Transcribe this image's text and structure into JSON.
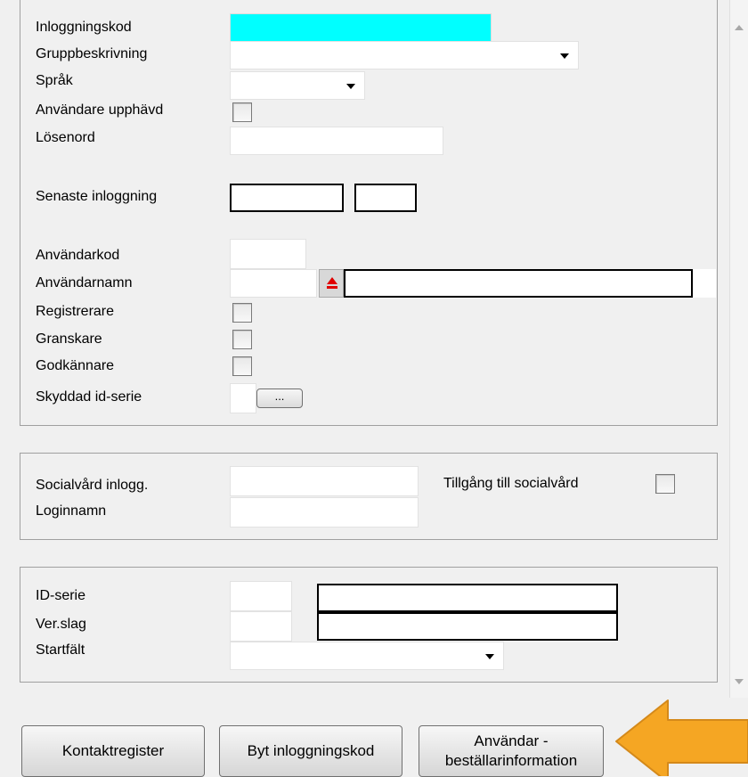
{
  "user_section": {
    "login_code": {
      "label": "Inloggningskod",
      "value": ""
    },
    "group_description": {
      "label": "Gruppbeskrivning",
      "value": ""
    },
    "language": {
      "label": "Språk",
      "value": ""
    },
    "user_revoked": {
      "label": "Användare upphävd",
      "checked": false
    },
    "password": {
      "label": "Lösenord",
      "value": ""
    },
    "last_login": {
      "label": "Senaste inloggning",
      "date": "",
      "time": ""
    },
    "user_code": {
      "label": "Användarkod",
      "value": ""
    },
    "user_name": {
      "label": "Användarnamn",
      "code": "",
      "name": ""
    },
    "registrar": {
      "label": "Registrerare",
      "checked": false
    },
    "reviewer": {
      "label": "Granskare",
      "checked": false
    },
    "approver": {
      "label": "Godkännare",
      "checked": false
    },
    "protected_id_series": {
      "label": "Skyddad id-serie",
      "value": "",
      "button_label": "..."
    }
  },
  "social_section": {
    "social_login": {
      "label": "Socialvård inlogg.",
      "value": ""
    },
    "login_name": {
      "label": "Loginnamn",
      "value": ""
    },
    "social_access": {
      "label": "Tillgång till socialvård",
      "checked": false
    }
  },
  "series_section": {
    "id_series": {
      "label": "ID-serie",
      "code": "",
      "description": ""
    },
    "voucher_type": {
      "label": "Ver.slag",
      "code": "",
      "description": ""
    },
    "start_field": {
      "label": "Startfält",
      "value": ""
    }
  },
  "buttons": {
    "contact_register": "Kontaktregister",
    "change_login_code": "Byt inloggningskod",
    "user_orderer_line1": "Användar -",
    "user_orderer_line2": "beställarinformation"
  },
  "colors": {
    "login_field": "#00ffff",
    "arrow_fill": "#f5a623",
    "arrow_stroke": "#d4891a"
  },
  "icons": {
    "eject": "eject-icon",
    "dropdown": "chevron-down-icon",
    "pointer": "arrow-left-icon"
  }
}
